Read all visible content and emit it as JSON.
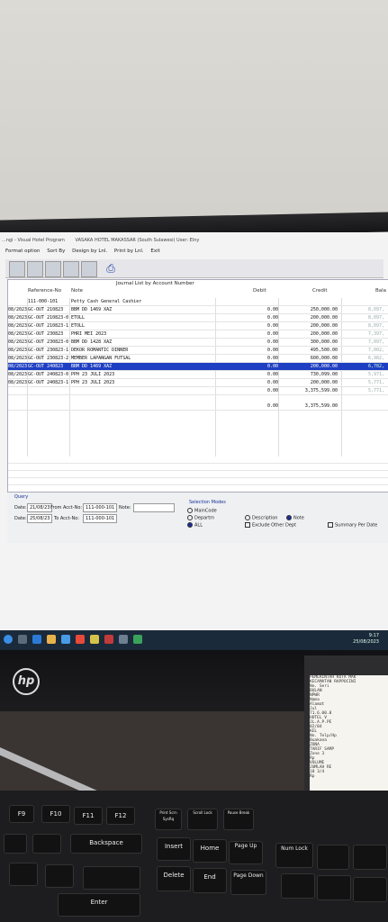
{
  "app": {
    "title_prefix": "...ngi - Visual Hotel Program",
    "hotel": "VASAKA HOTEL MAKASSAR (South Sulawesi) User: Elny"
  },
  "menu": [
    "Format option",
    "Sort By",
    "Design by Lnl.",
    "Print by Lnl.",
    "Exit"
  ],
  "grid": {
    "title": "Journal List by Account Number",
    "headers": {
      "ref": "Reference-No",
      "note": "Note",
      "debit": "Debit",
      "credit": "Credit",
      "balance": "Bala"
    },
    "account_row": {
      "ref": "111-000-101",
      "note": "Petty Cash General Cashier"
    },
    "rows": [
      {
        "date": "08/2023",
        "ref": "GC-OUT 210823",
        "note": "BBM DD 1469 XAZ",
        "debit": "0.00",
        "credit": "250,000.00",
        "bal": "8,097,"
      },
      {
        "date": "08/2023",
        "ref": "GC-OUT 210823-0",
        "note": "ETOLL",
        "debit": "0.00",
        "credit": "200,000.00",
        "bal": "8,097,"
      },
      {
        "date": "08/2023",
        "ref": "GC-OUT 210823-1",
        "note": "ETOLL",
        "debit": "0.00",
        "credit": "200,000.00",
        "bal": "8,097,"
      },
      {
        "date": "08/2023",
        "ref": "GC-OUT 230823",
        "note": "PHRI MEI 2023",
        "debit": "0.00",
        "credit": "200,000.00",
        "bal": "7,397,"
      },
      {
        "date": "08/2023",
        "ref": "GC-OUT 230823-0",
        "note": "BBM DD 1428 XAZ",
        "debit": "0.00",
        "credit": "300,000.00",
        "bal": "7,097,"
      },
      {
        "date": "08/2023",
        "ref": "GC-OUT 230823-1",
        "note": "DEKOR ROMANTIC DINNER",
        "debit": "0.00",
        "credit": "495,500.00",
        "bal": "7,002,"
      },
      {
        "date": "08/2023",
        "ref": "GC-OUT 230823-2",
        "note": "MEMBER LAPANGAN FUTSAL",
        "debit": "0.00",
        "credit": "600,000.00",
        "bal": "6,982,"
      },
      {
        "date": "08/2023",
        "ref": "GC-OUT 240823",
        "note": "BBM DD 1469 XAZ",
        "debit": "0.00",
        "credit": "200,000.00",
        "bal": "6,782,",
        "selected": true
      },
      {
        "date": "08/2023",
        "ref": "GC-OUT 240823-0",
        "note": "PPH 23 JULI 2023",
        "debit": "0.00",
        "credit": "730,099.00",
        "bal": "5,971,"
      },
      {
        "date": "08/2023",
        "ref": "GC-OUT 240823-1",
        "note": "PPH 23 JULI 2023",
        "debit": "0.00",
        "credit": "200,000.00",
        "bal": "5,771,"
      },
      {
        "date": "",
        "ref": "",
        "note": "",
        "debit": "0.00",
        "credit": "3,375,599.00",
        "bal": "5,771,"
      }
    ],
    "total": {
      "debit": "0.00",
      "credit": "3,375,599.00"
    }
  },
  "query": {
    "label": "Query",
    "from_date_label": "Date:",
    "from_date": "21/08/23",
    "to_date_label": "Date:",
    "to_date": "25/08/23",
    "from_acct_label": "From Acct-No:",
    "from_acct": "111-000-101",
    "to_acct_label": "To Acct-No:",
    "to_acct": "111-000-101",
    "note_label": "Note:"
  },
  "selection": {
    "label": "Selection Modes",
    "maincode": "MainCode",
    "departm": "Departm",
    "all": "ALL",
    "description": "Description",
    "note": "Note",
    "exclude": "Exclude Other Dept",
    "summary": "Summary Per Date"
  },
  "taskbar": {
    "time": "9:17",
    "date": "25/08/2023"
  },
  "keyboard": {
    "keys": [
      "F9",
      "F10",
      "F11",
      "F12",
      "Print Scrn SysRq",
      "Scroll Lock",
      "Pause Break",
      "Backspace",
      "Insert",
      "Home",
      "Page Up",
      "Num Lock",
      "Delete",
      "End",
      "Page Down",
      "Enter"
    ]
  },
  "receipt": [
    "PEMERINTAH KOTA MAK",
    "KECAMATAN RAPPOCINI",
    "No. Seri",
    "BULAN",
    "NPWR",
    "Nama",
    "Alamat",
    "Jul",
    "71.6.00.0",
    "HOTEL V",
    "JL.A.P.PE",
    "02/04",
    "KEL",
    "No. Telp/Hp",
    "Buakana",
    "ZONA",
    "TARIF SAMP",
    "Zone 3",
    "Rp",
    "VOLUME",
    "JUMLAH RE",
    "18 3/4",
    "Rp"
  ]
}
